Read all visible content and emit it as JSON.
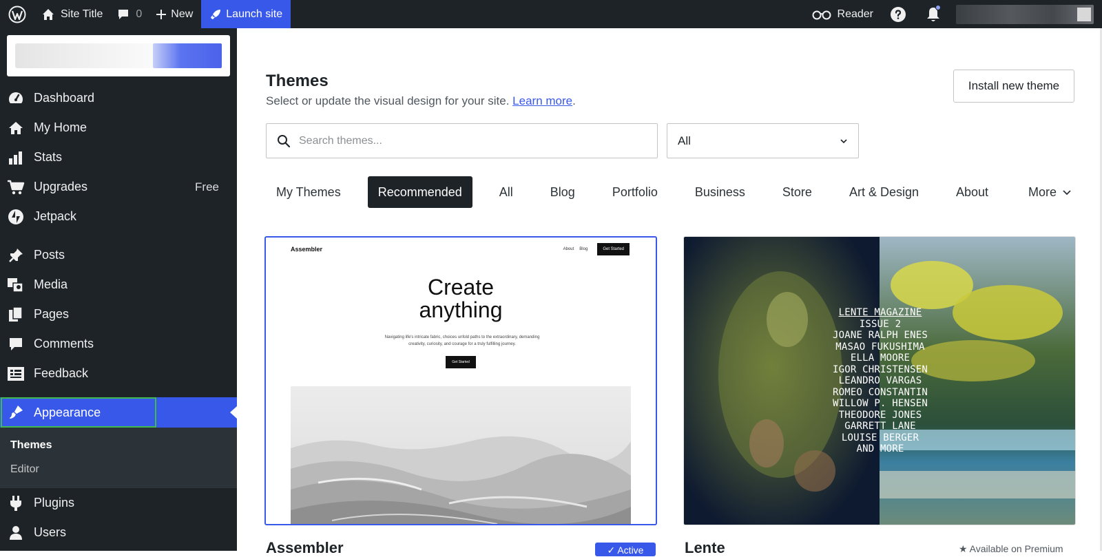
{
  "adminbar": {
    "site_title": "Site Title",
    "comments_count": "0",
    "new_label": "New",
    "launch_label": "Launch site",
    "reader_label": "Reader"
  },
  "sidebar": {
    "items": [
      {
        "label": "Dashboard",
        "icon": "dashboard-icon"
      },
      {
        "label": "My Home",
        "icon": "home-icon"
      },
      {
        "label": "Stats",
        "icon": "stats-icon"
      },
      {
        "label": "Upgrades",
        "icon": "cart-icon",
        "badge": "Free"
      },
      {
        "label": "Jetpack",
        "icon": "jetpack-icon"
      },
      {
        "label": "Posts",
        "icon": "pin-icon"
      },
      {
        "label": "Media",
        "icon": "media-icon"
      },
      {
        "label": "Pages",
        "icon": "pages-icon"
      },
      {
        "label": "Comments",
        "icon": "comment-icon"
      },
      {
        "label": "Feedback",
        "icon": "feedback-icon"
      },
      {
        "label": "Appearance",
        "icon": "brush-icon"
      },
      {
        "label": "Plugins",
        "icon": "plug-icon"
      },
      {
        "label": "Users",
        "icon": "user-icon"
      }
    ],
    "appearance_sub": [
      "Themes",
      "Editor"
    ]
  },
  "main": {
    "title": "Themes",
    "subtitle": "Select or update the visual design for your site.",
    "learn_more": "Learn more",
    "period": ".",
    "install_label": "Install new theme",
    "search_placeholder": "Search themes...",
    "filter_value": "All",
    "tabs": [
      "My Themes",
      "Recommended",
      "All",
      "Blog",
      "Portfolio",
      "Business",
      "Store",
      "Art & Design",
      "About"
    ],
    "more_label": "More",
    "selected_tab": "Recommended"
  },
  "themes": [
    {
      "name": "Assembler",
      "badge": "✓ Active",
      "preview": {
        "brand": "Assembler",
        "nav": [
          "About",
          "Blog"
        ],
        "nav_button": "Get Started",
        "hero_line1": "Create",
        "hero_line2": "anything",
        "desc": "Navigating life's intricate fabric, choices unfold paths to the extraordinary, demanding creativity, curiosity, and courage for a truly fulfilling journey.",
        "cta": "Get Started"
      }
    },
    {
      "name": "Lente",
      "badge": "★ Available on Premium",
      "preview_lines": [
        "LENTE MAGAZINE",
        "ISSUE 2",
        "JOANE RALPH ENES",
        "MASAO FUKUSHIMA",
        "ELLA MOORE",
        "IGOR CHRISTENSEN",
        "LEANDRO VARGAS",
        "ROMEO CONSTANTIN",
        "WILLOW P. HENSEN",
        "THEODORE JONES",
        "GARRETT LANE",
        "LOUISE BERGER",
        "AND MORE"
      ]
    }
  ],
  "colors": {
    "admin_bg": "#1d2327",
    "accent": "#3858e9",
    "focus_outline": "#3fb950"
  }
}
